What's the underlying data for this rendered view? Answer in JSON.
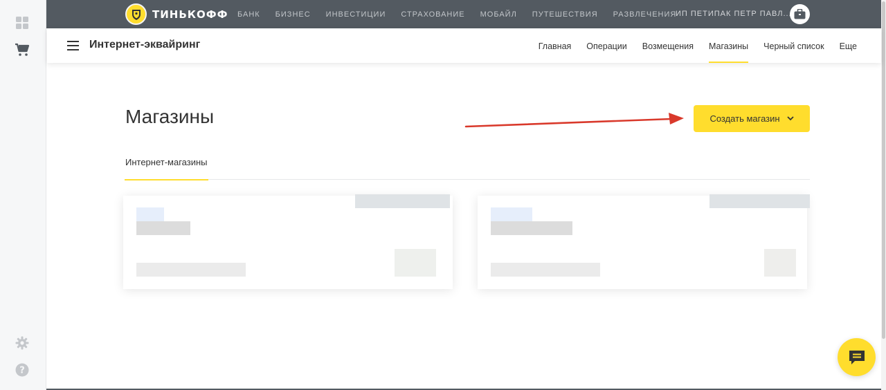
{
  "topbar": {
    "brand": "ТИНЬКОФФ",
    "nav": [
      "БАНК",
      "БИЗНЕС",
      "ИНВЕСТИЦИИ",
      "СТРАХОВАНИЕ",
      "МОБАЙЛ",
      "ПУТЕШЕСТВИЯ",
      "РАЗВЛЕЧЕНИЯ"
    ],
    "org_name": "ИП ПЕТИПАК ПЕТР ПАВЛ..."
  },
  "subheader": {
    "title": "Интернет-эквайринг",
    "nav": [
      "Главная",
      "Операции",
      "Возмещения",
      "Магазины",
      "Черный список",
      "Еще"
    ],
    "active": "Магазины"
  },
  "page": {
    "title": "Магазины",
    "create_button": "Создать магазин",
    "tab": "Интернет-магазины"
  },
  "icons": {
    "rail_top": [
      "grid-icon",
      "cart-icon"
    ],
    "rail_bottom": [
      "gear-icon",
      "help-icon"
    ],
    "chat": "chat-icon"
  },
  "colors": {
    "accent": "#ffdd2d",
    "topbar": "#535a61",
    "arrow": "#d9392b"
  }
}
